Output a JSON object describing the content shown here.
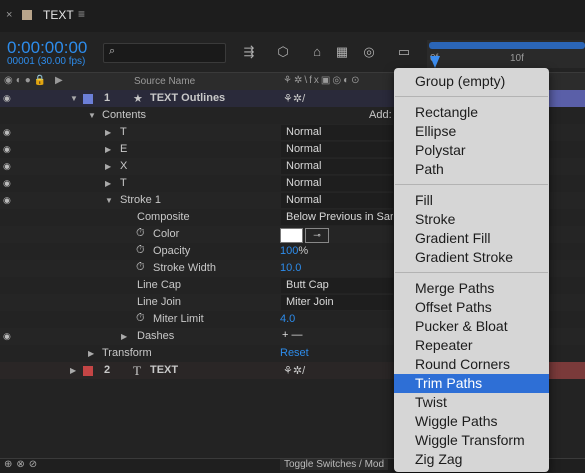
{
  "tab": {
    "close": "×",
    "title": "TEXT",
    "menu": "≡"
  },
  "header": {
    "timecode": "0:00:00:00",
    "fps": "00001 (30.00 fps)",
    "search_icon": "⌕"
  },
  "ruler": {
    "start": "0f",
    "tick": "10f"
  },
  "columns": {
    "source_name": "Source Name"
  },
  "layers": [
    {
      "num": "1",
      "name": "TEXT Outlines",
      "star": "★",
      "color": "#6c7fd8"
    },
    {
      "num": "2",
      "name": "TEXT",
      "type": "T",
      "color": "#c44545"
    }
  ],
  "rows": {
    "contents": "Contents",
    "add": "Add:",
    "groups": [
      {
        "name": "T",
        "mode": "Normal"
      },
      {
        "name": "E",
        "mode": "Normal"
      },
      {
        "name": "X",
        "mode": "Normal"
      },
      {
        "name": "T",
        "mode": "Normal"
      }
    ],
    "stroke1": {
      "name": "Stroke 1",
      "mode": "Normal"
    },
    "composite": {
      "label": "Composite",
      "value": "Below Previous in Sar"
    },
    "color": {
      "label": "Color"
    },
    "opacity": {
      "label": "Opacity",
      "value": "100",
      "unit": "%"
    },
    "stroke_width": {
      "label": "Stroke Width",
      "value": "10.0"
    },
    "line_cap": {
      "label": "Line Cap",
      "value": "Butt Cap"
    },
    "line_join": {
      "label": "Line Join",
      "value": "Miter Join"
    },
    "miter_limit": {
      "label": "Miter Limit",
      "value": "4.0"
    },
    "dashes": {
      "label": "Dashes",
      "controls": "+ —"
    },
    "transform": {
      "label": "Transform",
      "value": "Reset"
    }
  },
  "bottom": {
    "toggle": "Toggle Switches / Mod"
  },
  "menu": {
    "items": [
      "Group (empty)",
      "Rectangle",
      "Ellipse",
      "Polystar",
      "Path",
      "Fill",
      "Stroke",
      "Gradient Fill",
      "Gradient Stroke",
      "Merge Paths",
      "Offset Paths",
      "Pucker & Bloat",
      "Repeater",
      "Round Corners",
      "Trim Paths",
      "Twist",
      "Wiggle Paths",
      "Wiggle Transform",
      "Zig Zag"
    ],
    "selected": "Trim Paths"
  },
  "colors": {
    "accent": "#2d8ceb",
    "menu_selected": "#2e6fd6"
  }
}
